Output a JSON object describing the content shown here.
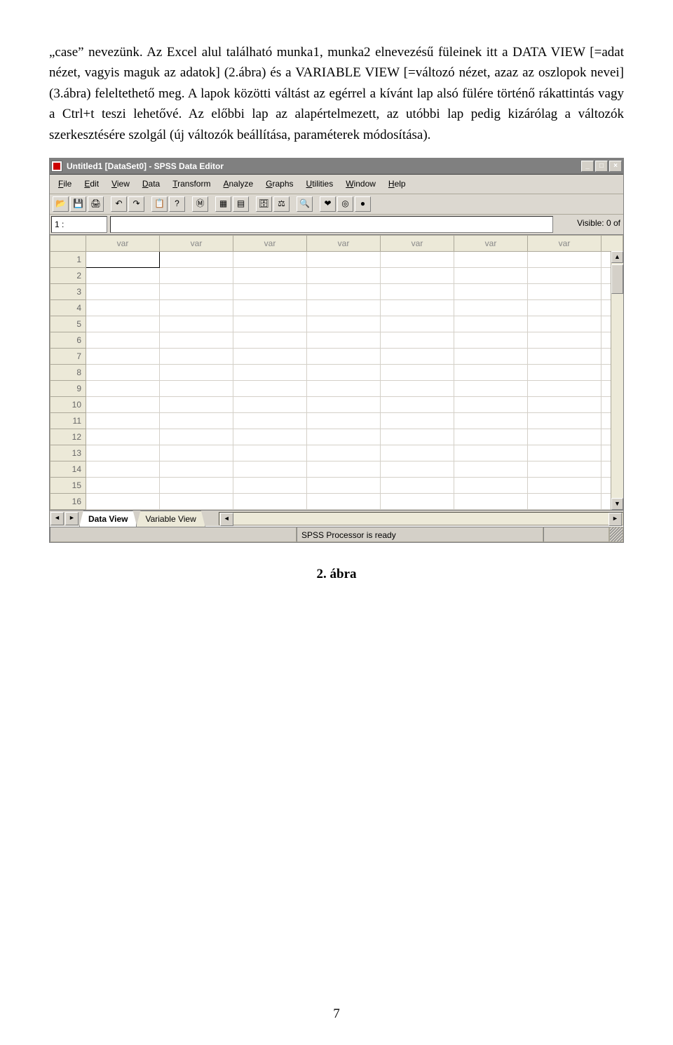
{
  "paragraph": "„case” nevezünk. Az Excel alul található munka1, munka2 elnevezésű füleinek itt a DATA VIEW [=adat nézet, vagyis maguk az adatok] (2.ábra) és a VARIABLE VIEW [=változó nézet, azaz az oszlopok nevei] (3.ábra) feleltethető meg. A lapok közötti váltást az egérrel a kívánt lap alsó fülére történő rákattintás vagy a Ctrl+t teszi lehetővé. Az előbbi lap az alapértelmezett, az utóbbi lap pedig kizárólag a változók szerkesztésére szolgál (új változók beállítása, paraméterek módosítása).",
  "caption": "2. ábra",
  "page_number": "7",
  "screenshot": {
    "title": "Untitled1 [DataSet0] - SPSS Data Editor",
    "window_buttons": {
      "min": "_",
      "max": "□",
      "close": "×"
    },
    "menubar": [
      "File",
      "Edit",
      "View",
      "Data",
      "Transform",
      "Analyze",
      "Graphs",
      "Utilities",
      "Window",
      "Help"
    ],
    "toolbar_glyphs": [
      "📂",
      "💾",
      "🖨",
      "",
      "↶",
      "↷",
      "",
      "📋",
      "?",
      "",
      "Ⓜ",
      "",
      "▦",
      "▤",
      "",
      "🗄",
      "⚖",
      "",
      "🔍",
      "",
      "❤",
      "◎",
      "●"
    ],
    "cell_ref": "1 :",
    "visible_label": "Visible: 0 of",
    "col_header": "var",
    "columns": 7,
    "rows": 16,
    "tabs": {
      "data": "Data View",
      "var": "Variable View"
    },
    "status": "SPSS Processor is ready"
  }
}
